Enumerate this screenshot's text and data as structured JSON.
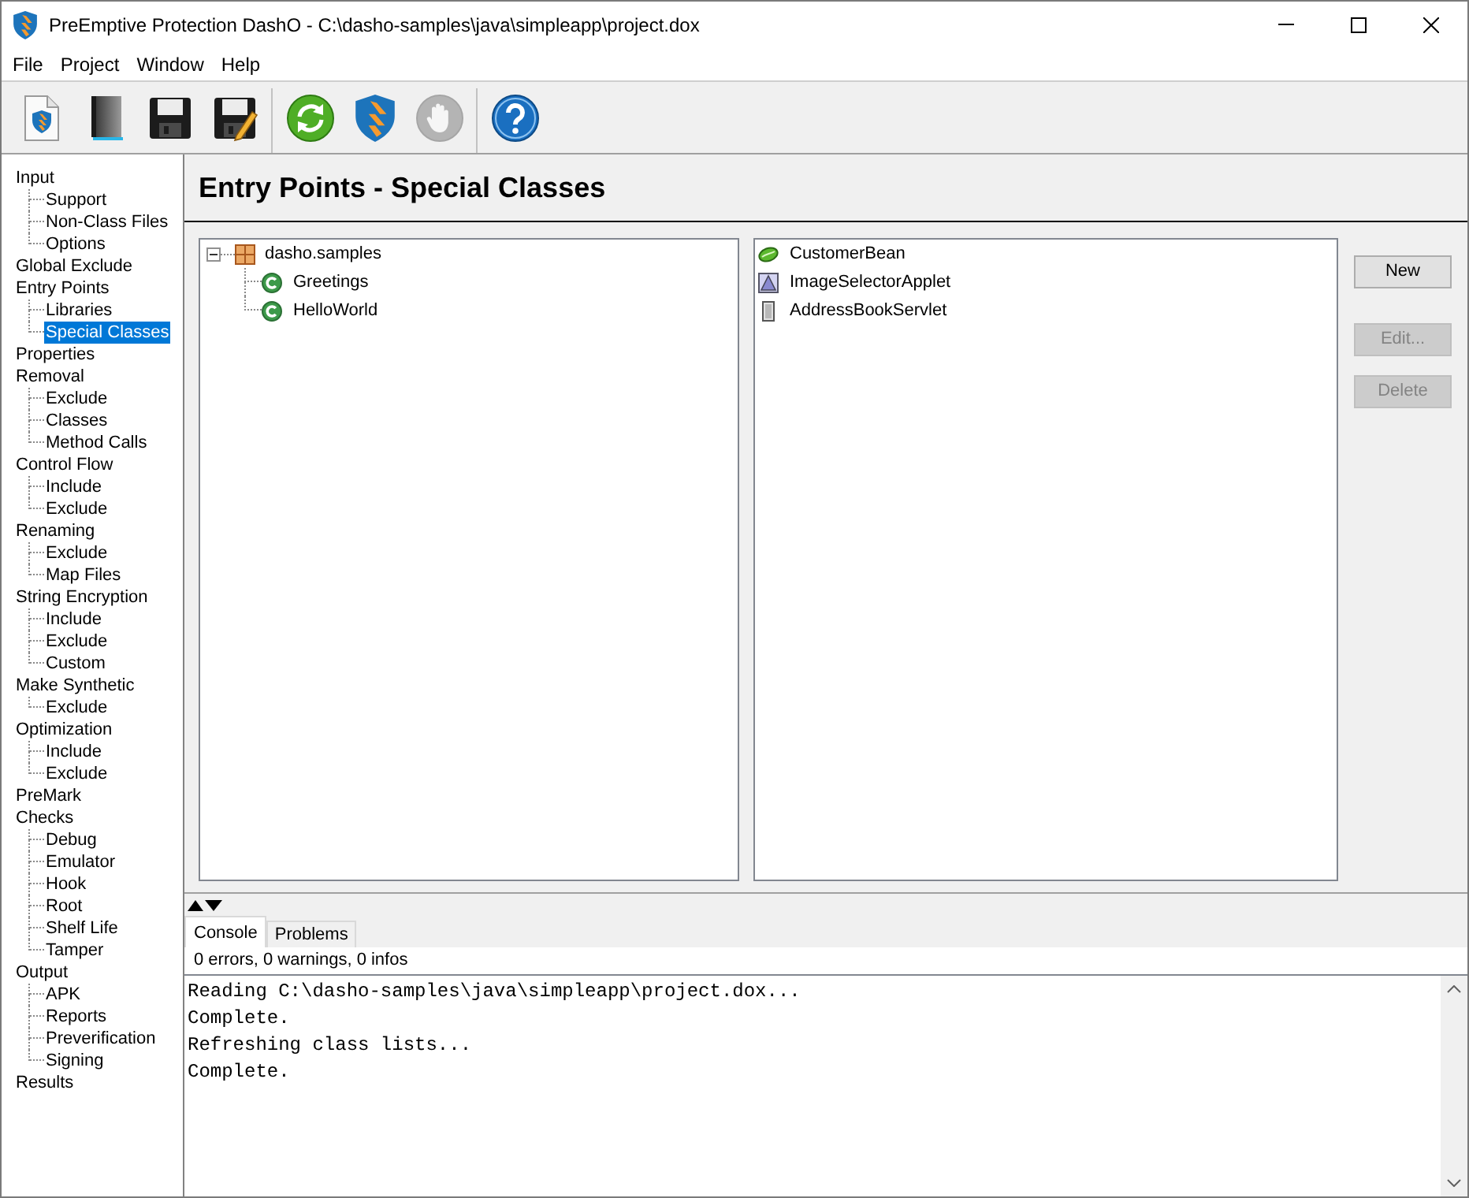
{
  "window": {
    "title": "PreEmptive Protection DashO - C:\\dasho-samples\\java\\simpleapp\\project.dox"
  },
  "menu": [
    "File",
    "Project",
    "Window",
    "Help"
  ],
  "toolbar": {
    "groups": [
      {
        "buttons": [
          {
            "kind": "new-project",
            "disabled": false
          },
          {
            "kind": "open-project",
            "disabled": false
          },
          {
            "kind": "save",
            "disabled": false
          },
          {
            "kind": "save-as",
            "disabled": false
          }
        ]
      },
      {
        "buttons": [
          {
            "kind": "refresh",
            "disabled": false
          },
          {
            "kind": "build",
            "disabled": false
          },
          {
            "kind": "stop",
            "disabled": true
          }
        ]
      },
      {
        "buttons": [
          {
            "kind": "help",
            "disabled": false
          }
        ]
      }
    ]
  },
  "sidebar": {
    "items": [
      {
        "label": "Input",
        "selected": false,
        "children": [
          {
            "label": "Support",
            "selected": false
          },
          {
            "label": "Non-Class Files",
            "selected": false
          },
          {
            "label": "Options",
            "selected": false
          }
        ]
      },
      {
        "label": "Global Exclude",
        "selected": false
      },
      {
        "label": "Entry Points",
        "selected": false,
        "children": [
          {
            "label": "Libraries",
            "selected": false
          },
          {
            "label": "Special Classes",
            "selected": true
          }
        ]
      },
      {
        "label": "Properties",
        "selected": false
      },
      {
        "label": "Removal",
        "selected": false,
        "children": [
          {
            "label": "Exclude",
            "selected": false
          },
          {
            "label": "Classes",
            "selected": false
          },
          {
            "label": "Method Calls",
            "selected": false
          }
        ]
      },
      {
        "label": "Control Flow",
        "selected": false,
        "children": [
          {
            "label": "Include",
            "selected": false
          },
          {
            "label": "Exclude",
            "selected": false
          }
        ]
      },
      {
        "label": "Renaming",
        "selected": false,
        "children": [
          {
            "label": "Exclude",
            "selected": false
          },
          {
            "label": "Map Files",
            "selected": false
          }
        ]
      },
      {
        "label": "String Encryption",
        "selected": false,
        "children": [
          {
            "label": "Include",
            "selected": false
          },
          {
            "label": "Exclude",
            "selected": false
          },
          {
            "label": "Custom",
            "selected": false
          }
        ]
      },
      {
        "label": "Make Synthetic",
        "selected": false,
        "children": [
          {
            "label": "Exclude",
            "selected": false
          }
        ]
      },
      {
        "label": "Optimization",
        "selected": false,
        "children": [
          {
            "label": "Include",
            "selected": false
          },
          {
            "label": "Exclude",
            "selected": false
          }
        ]
      },
      {
        "label": "PreMark",
        "selected": false
      },
      {
        "label": "Checks",
        "selected": false,
        "children": [
          {
            "label": "Debug",
            "selected": false
          },
          {
            "label": "Emulator",
            "selected": false
          },
          {
            "label": "Hook",
            "selected": false
          },
          {
            "label": "Root",
            "selected": false
          },
          {
            "label": "Shelf Life",
            "selected": false
          },
          {
            "label": "Tamper",
            "selected": false
          }
        ]
      },
      {
        "label": "Output",
        "selected": false,
        "children": [
          {
            "label": "APK",
            "selected": false
          },
          {
            "label": "Reports",
            "selected": false
          },
          {
            "label": "Preverification",
            "selected": false
          },
          {
            "label": "Signing",
            "selected": false
          }
        ]
      },
      {
        "label": "Results",
        "selected": false
      }
    ]
  },
  "page_title": "Entry Points - Special Classes",
  "class_tree": {
    "items": [
      {
        "label": "dasho.samples",
        "kind": "package",
        "expanded": true,
        "children": [
          {
            "label": "Greetings",
            "kind": "class"
          },
          {
            "label": "HelloWorld",
            "kind": "class"
          }
        ]
      }
    ]
  },
  "special_classes": {
    "items": [
      {
        "label": "CustomerBean",
        "kind": "bean"
      },
      {
        "label": "ImageSelectorApplet",
        "kind": "applet"
      },
      {
        "label": "AddressBookServlet",
        "kind": "servlet"
      }
    ]
  },
  "buttons": [
    {
      "label": "New",
      "disabled": false
    },
    {
      "label": "Edit...",
      "disabled": true
    },
    {
      "label": "Delete",
      "disabled": true
    }
  ],
  "bottom_panel": {
    "tabs": [
      {
        "label": "Console",
        "selected": true
      },
      {
        "label": "Problems",
        "selected": false
      }
    ],
    "status": "0 errors, 0 warnings, 0 infos",
    "console_lines": [
      "Reading C:\\dasho-samples\\java\\simpleapp\\project.dox...",
      "Complete.",
      "Refreshing class lists...",
      "Complete."
    ]
  }
}
